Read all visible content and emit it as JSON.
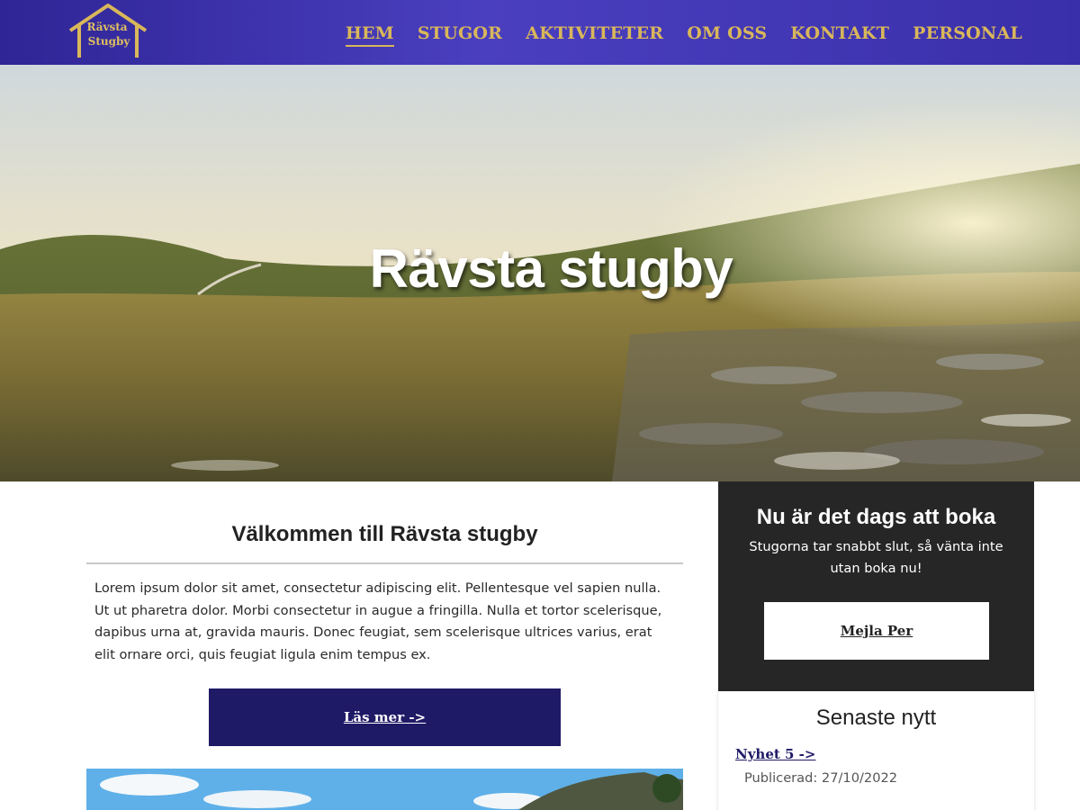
{
  "header": {
    "logo": {
      "line1": "Rävsta",
      "line2": "Stugby",
      "icon": "house-outline-icon"
    },
    "nav": [
      {
        "label": "HEM",
        "active": true
      },
      {
        "label": "STUGOR",
        "active": false
      },
      {
        "label": "AKTIVITETER",
        "active": false
      },
      {
        "label": "OM OSS",
        "active": false
      },
      {
        "label": "KONTAKT",
        "active": false
      },
      {
        "label": "PERSONAL",
        "active": false
      }
    ]
  },
  "hero": {
    "title": "Rävsta stugby"
  },
  "main": {
    "welcome_title": "Välkommen till Rävsta stugby",
    "welcome_body": "Lorem ipsum dolor sit amet, consectetur adipiscing elit. Pellentesque vel sapien nulla. Ut ut pharetra dolor. Morbi consectetur in augue a fringilla. Nulla et tortor scelerisque, dapibus urna at, gravida mauris. Donec feugiat, sem scelerisque ultrices varius, erat elit ornare orci, quis feugiat ligula enim tempus ex.",
    "read_more_label": "Läs mer ->"
  },
  "sidebar": {
    "book": {
      "title": "Nu är det dags att boka",
      "subtitle": "Stugorna tar snabbt slut, så vänta inte utan boka nu!",
      "button_label": "Mejla Per"
    },
    "news": {
      "title": "Senaste nytt",
      "items": [
        {
          "link": "Nyhet 5 ->",
          "published": "Publicerad: 27/10/2022"
        }
      ]
    }
  },
  "colors": {
    "header_bg": "#3a2faa",
    "nav_gold": "#d9b75a",
    "button_dark": "#1f1a66",
    "sidebar_dark": "#262626"
  }
}
